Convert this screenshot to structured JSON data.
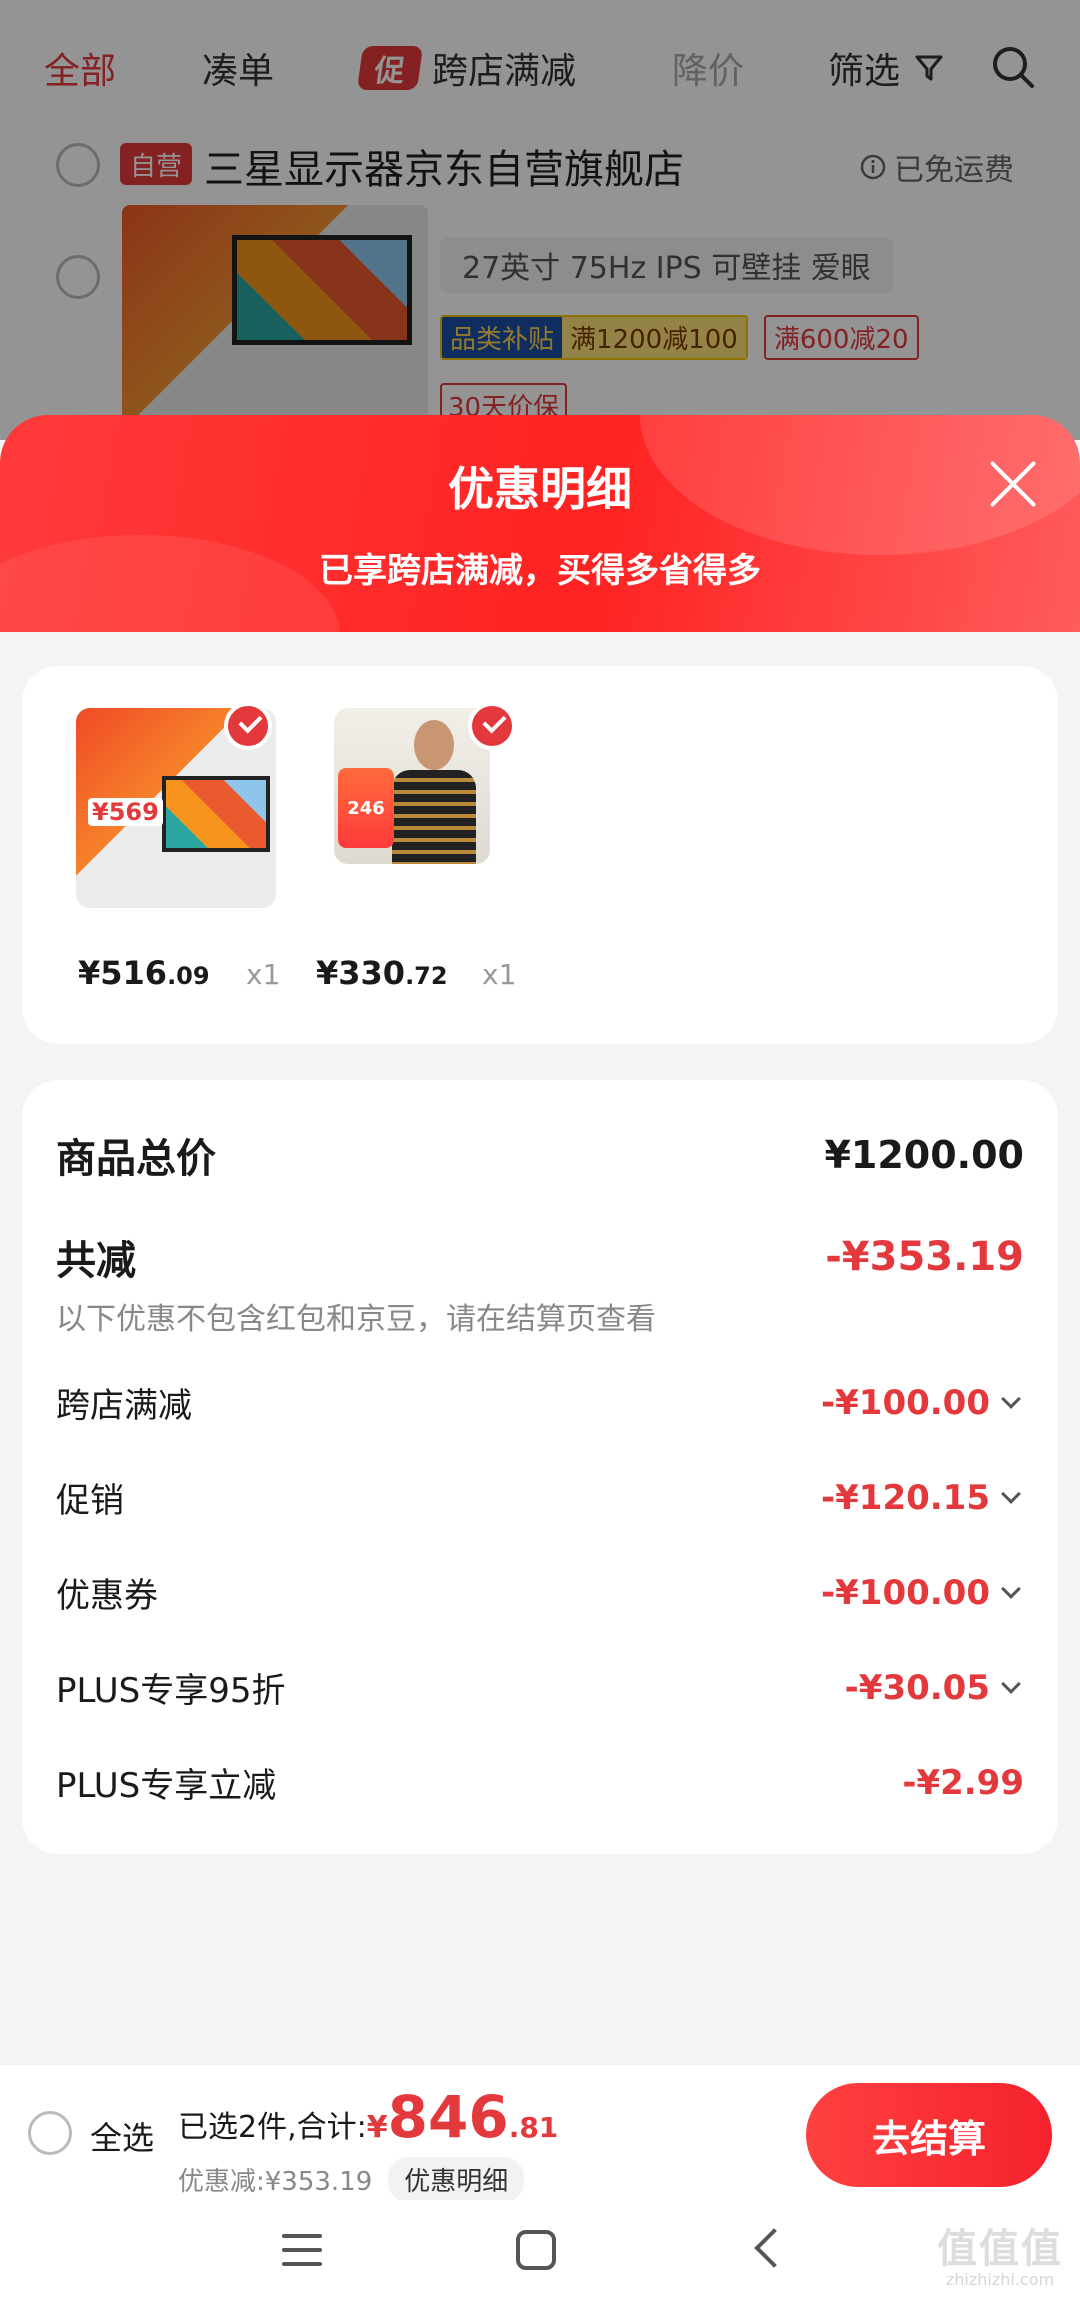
{
  "filter_bar": {
    "tabs": [
      "全部",
      "凑单",
      "跨店满减",
      "降价"
    ],
    "promo_badge": "促",
    "filter_label": "筛选"
  },
  "background_store": {
    "self_badge": "自营",
    "store_name": "三星显示器京东自营旗舰店",
    "free_shipping": "已免运费",
    "spec": "27英寸 75Hz IPS 可壁挂 爱眼",
    "tag_category": "品类补贴",
    "tag_category_offer": "满1200减100",
    "tag_offer": "满600减20",
    "tag_price_protect": "30天价保"
  },
  "sheet": {
    "title": "优惠明细",
    "subtitle": "已享跨店满减，买得多省得多"
  },
  "products": [
    {
      "price_int": "¥516",
      "price_dec": ".09",
      "qty": "x1",
      "badge_price": "¥569"
    },
    {
      "price_int": "¥330",
      "price_dec": ".72",
      "qty": "x1",
      "badge_price": "246"
    }
  ],
  "summary": {
    "total_label": "商品总价",
    "total_value": "¥1200.00",
    "reduce_label": "共减",
    "reduce_value": "-¥353.19",
    "note": "以下优惠不包含红包和京豆，请在结算页查看",
    "items": [
      {
        "label": "跨店满减",
        "value": "-¥100.00"
      },
      {
        "label": "促销",
        "value": "-¥120.15"
      },
      {
        "label": "优惠券",
        "value": "-¥100.00"
      },
      {
        "label": "PLUS专享95折",
        "value": "-¥30.05"
      },
      {
        "label": "PLUS专享立减",
        "value": "-¥2.99"
      }
    ]
  },
  "bottom_bar": {
    "select_all": "全选",
    "selected_text": "已选2件,合计:",
    "currency": "¥",
    "total_int": "846",
    "total_dec": ".81",
    "discount_text": "优惠减:¥353.19",
    "discount_detail": "优惠明细",
    "checkout": "去结算"
  },
  "watermark": {
    "text": "值值值",
    "sub": "zhizhizhi.com"
  },
  "colors": {
    "accent": "#e4393c",
    "sheet_header": "#ff2a2a"
  }
}
